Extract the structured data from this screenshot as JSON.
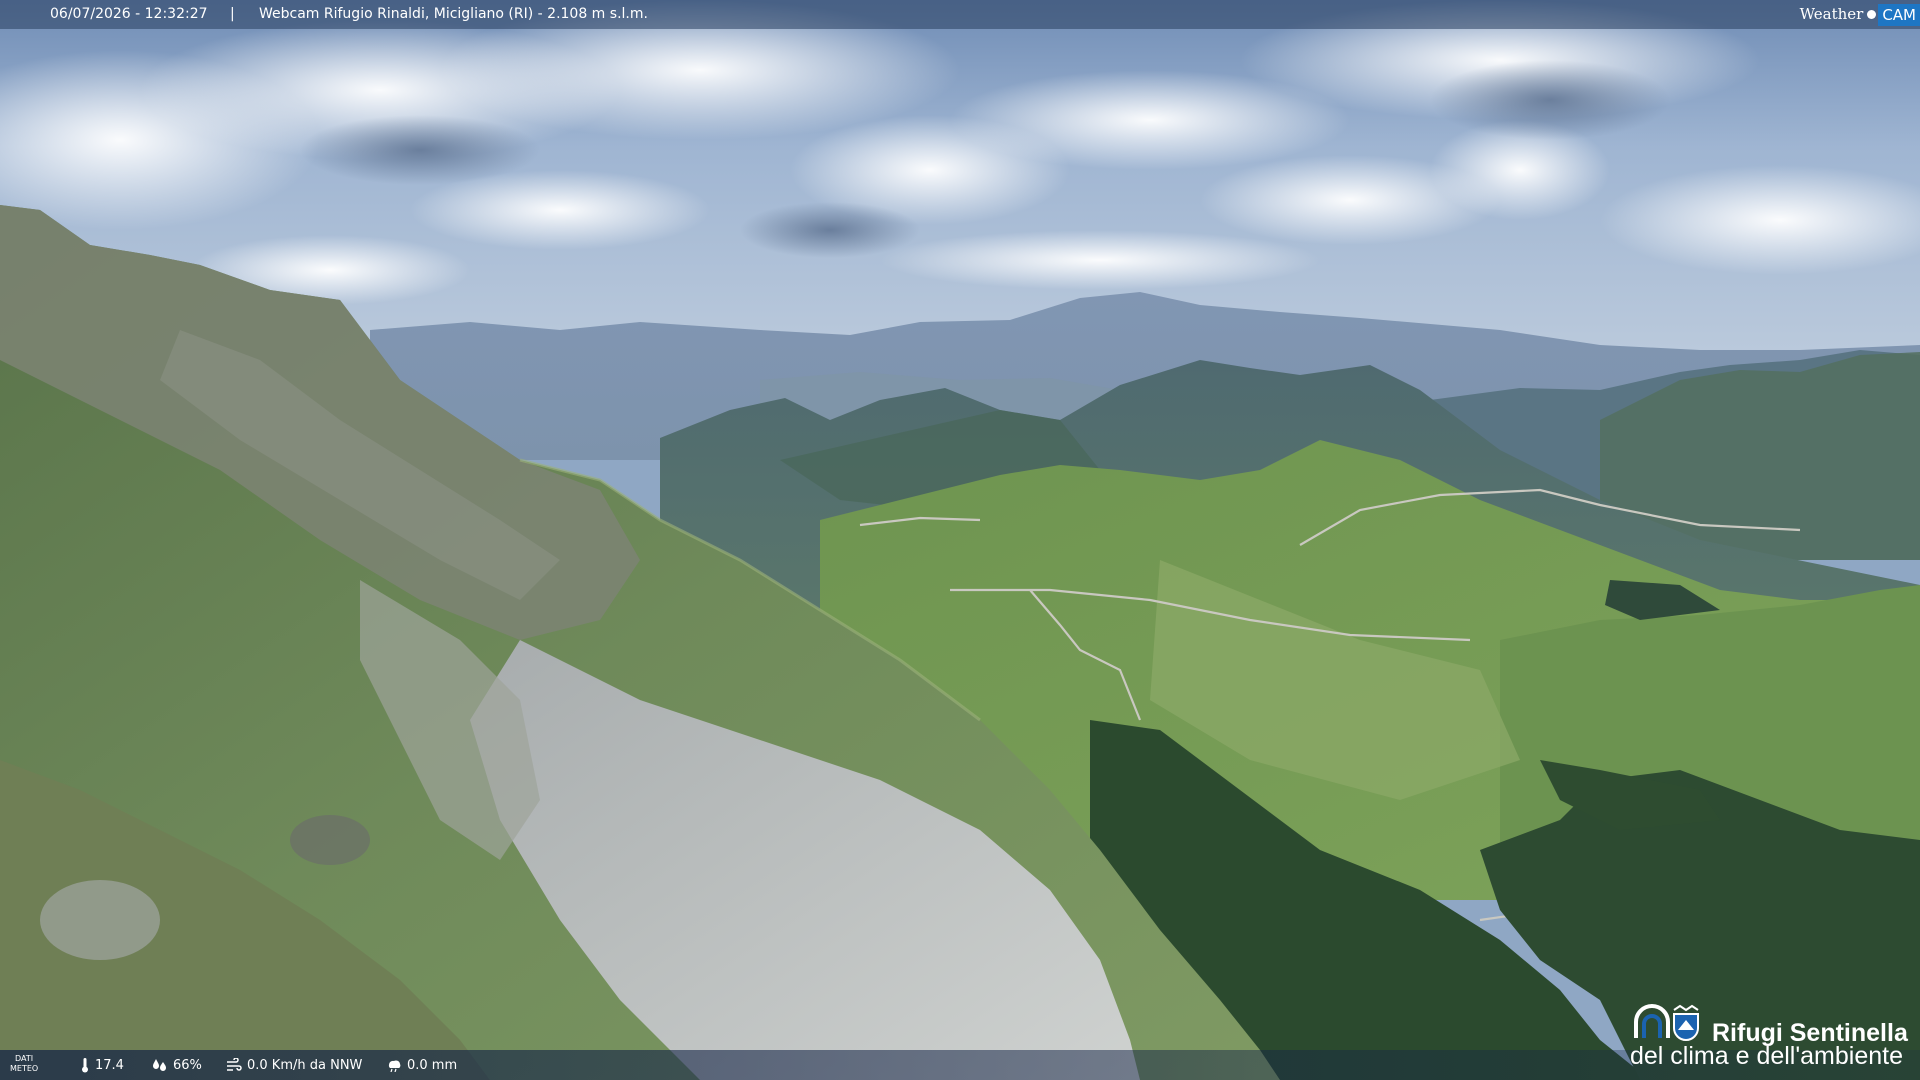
{
  "overlay": {
    "timestamp": "06/07/2026 - 12:32:27",
    "separator": "|",
    "title": "Webcam Rifugio Rinaldi, Micigliano (RI) - 2.108 m s.l.m.",
    "brand_left": "Weather",
    "brand_right": "CAM"
  },
  "weather": {
    "label_line1": "DATI",
    "label_line2": "METEO",
    "temperature": "17.4",
    "humidity": "66%",
    "wind": "0.0 Km/h da NNW",
    "rain": "0.0 mm",
    "icons": [
      "thermometer-icon",
      "humidity-icon",
      "wind-icon",
      "rain-icon"
    ]
  },
  "logo": {
    "line1": "Rifugi Sentinella",
    "line2": "del clima e dell'ambiente"
  }
}
